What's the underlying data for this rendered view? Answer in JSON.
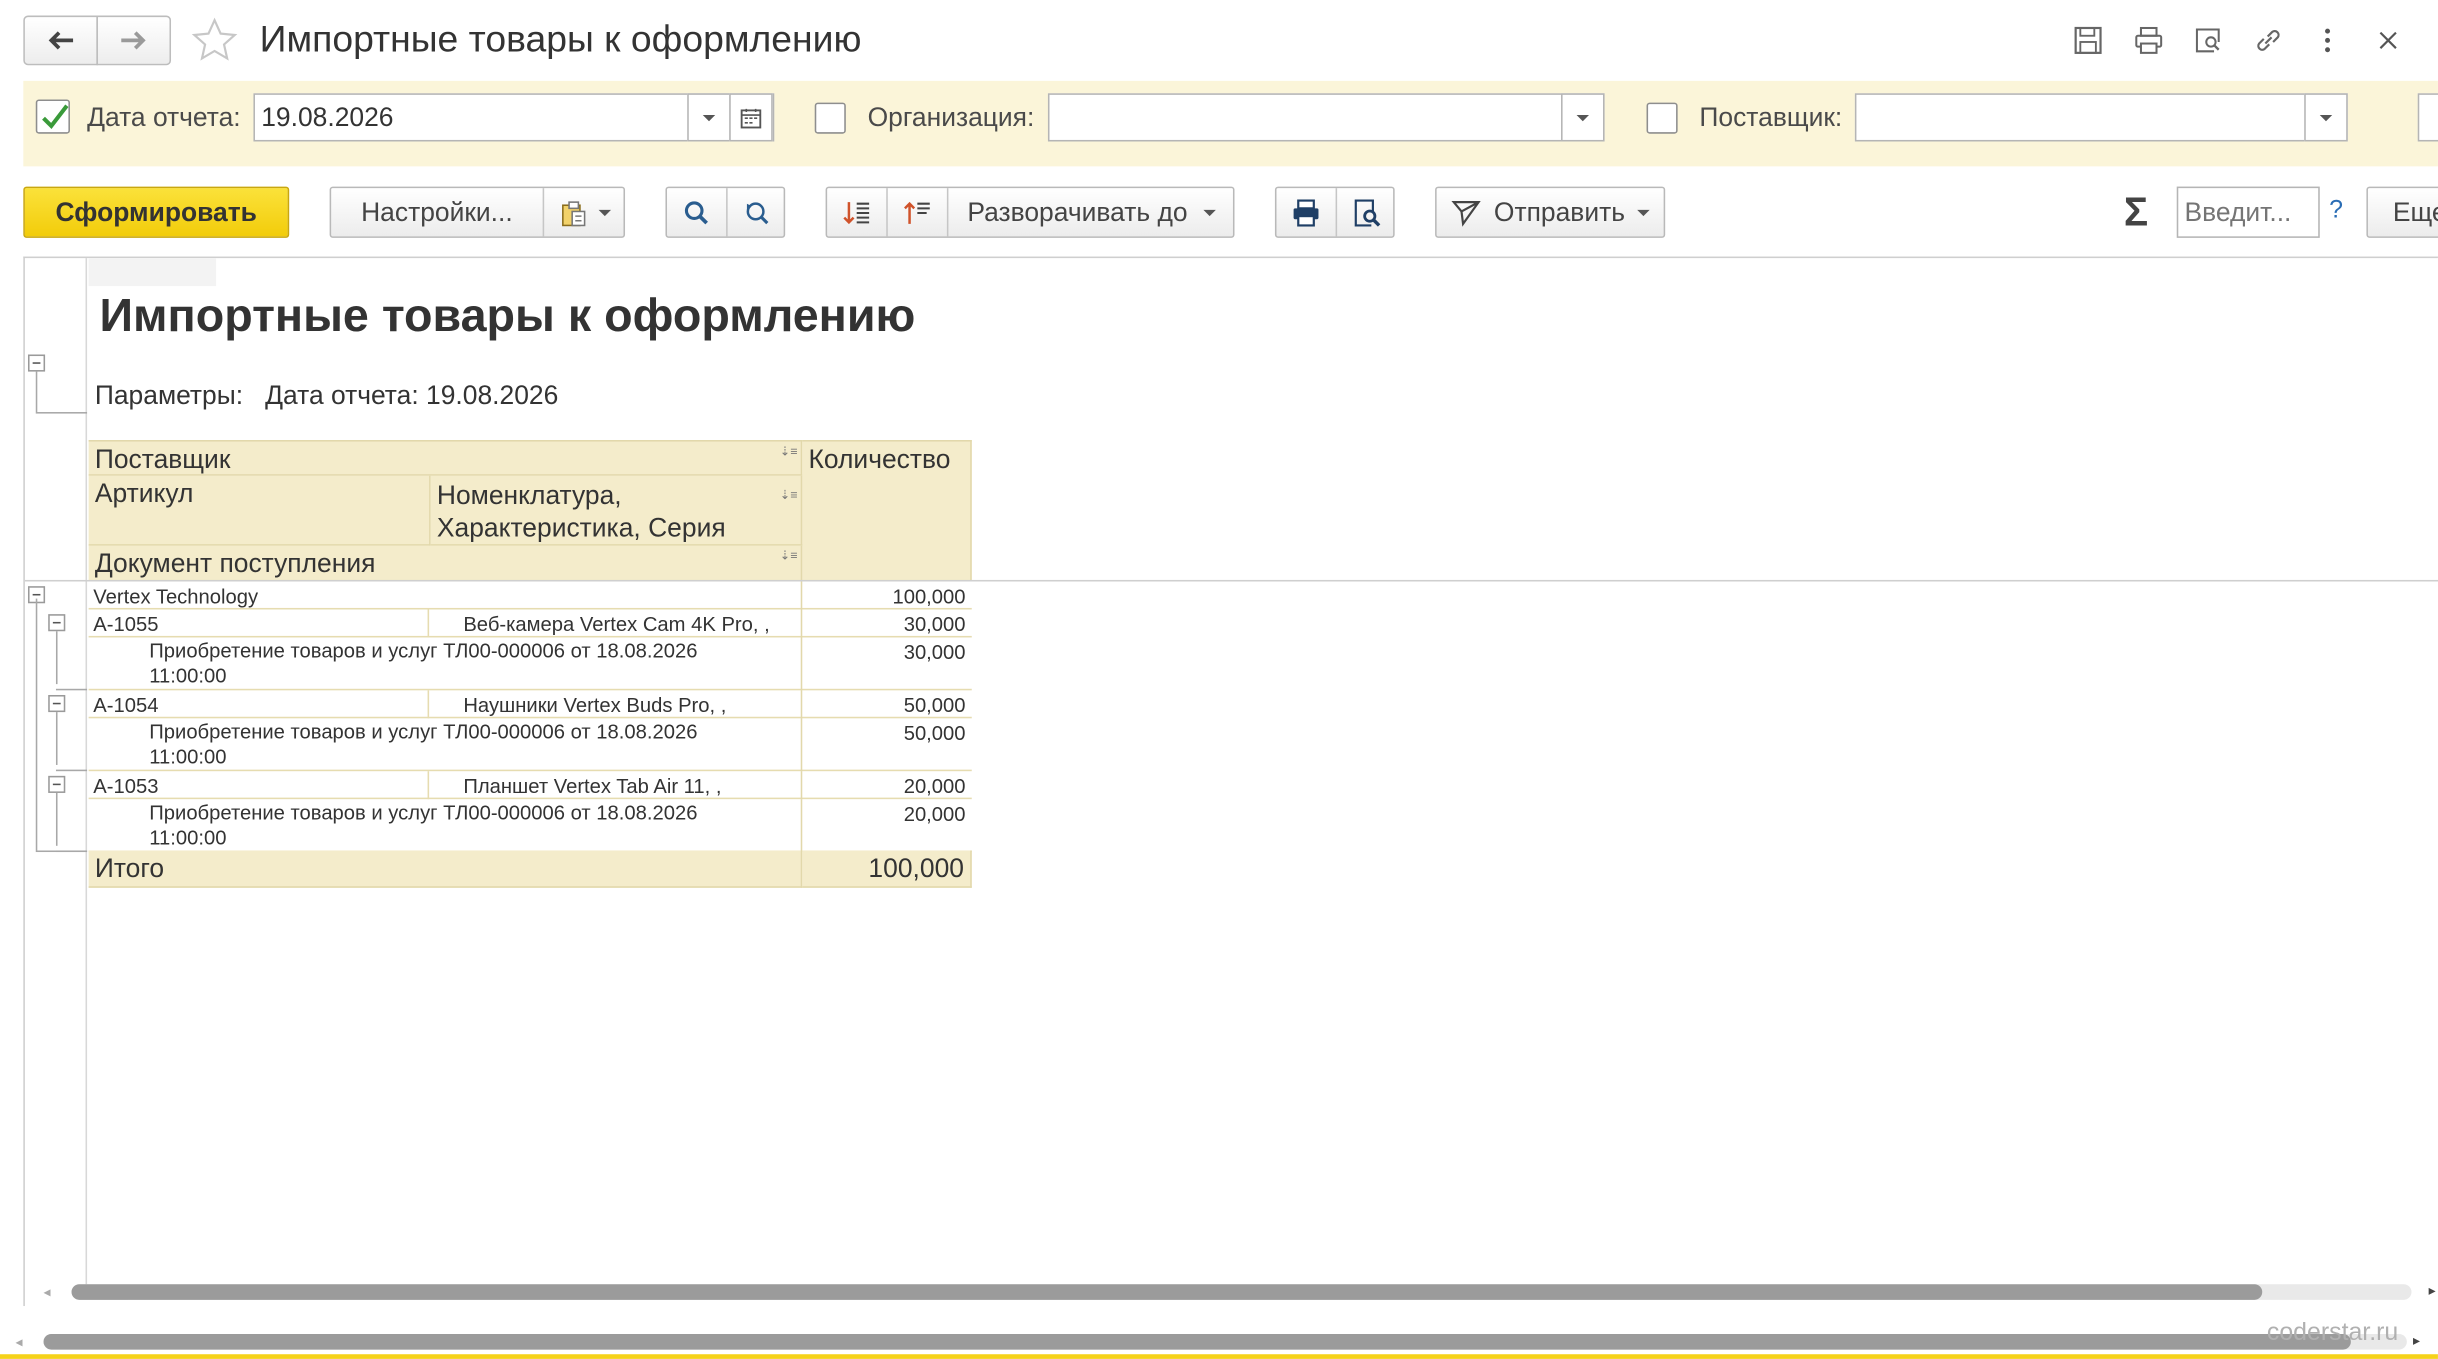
{
  "window": {
    "title": "Импортные товары к оформлению",
    "watermark": "coderstar.ru"
  },
  "params": {
    "report_date_label": "Дата отчета:",
    "report_date_value": "19.08.2026",
    "report_date_checked": true,
    "organization_label": "Организация:",
    "organization_value": "",
    "organization_checked": false,
    "supplier_label": "Поставщик:",
    "supplier_value": "",
    "supplier_checked": false
  },
  "toolbar": {
    "generate_label": "Сформировать",
    "settings_label": "Настройки...",
    "expand_label": "Разворачивать до",
    "send_label": "Отправить",
    "sum_symbol": "Σ",
    "input_placeholder": "Введит...",
    "help_label": "?",
    "more_label": "Еще"
  },
  "report": {
    "title": "Импортные товары к оформлению",
    "params_label": "Параметры:",
    "params_value": "Дата отчета: 19.08.2026",
    "headers": {
      "supplier": "Поставщик",
      "quantity": "Количество",
      "article": "Артикул",
      "nomenclature": "Номенклатура,",
      "nomenclature2": "Характеристика, Серия",
      "document": "Документ поступления"
    },
    "rows": [
      {
        "kind": "group",
        "c1": "Vertex Technology",
        "c2": "",
        "c3": "100,000"
      },
      {
        "kind": "item",
        "c1": "А-1055",
        "c2": "Веб-камера Vertex Cam 4K Pro, ,",
        "c3": "30,000"
      },
      {
        "kind": "doc",
        "c1": "Приобретение товаров и услуг ТЛ00-000006 от 18.08.2026",
        "c1b": "11:00:00",
        "c3": "30,000"
      },
      {
        "kind": "item",
        "c1": "А-1054",
        "c2": "Наушники Vertex Buds Pro, ,",
        "c3": "50,000"
      },
      {
        "kind": "doc",
        "c1": "Приобретение товаров и услуг ТЛ00-000006 от 18.08.2026",
        "c1b": "11:00:00",
        "c3": "50,000"
      },
      {
        "kind": "item",
        "c1": "А-1053",
        "c2": "Планшет Vertex Tab Air 11, ,",
        "c3": "20,000"
      },
      {
        "kind": "doc",
        "c1": "Приобретение товаров и услуг ТЛ00-000006 от 18.08.2026",
        "c1b": "11:00:00",
        "c3": "20,000"
      }
    ],
    "total_label": "Итого",
    "total_value": "100,000"
  },
  "colors": {
    "accent_yellow": "#f5d21a",
    "params_bg": "#fbf5d9",
    "header_cell_bg": "#f4eccb",
    "check_green": "#3a9a3a"
  }
}
